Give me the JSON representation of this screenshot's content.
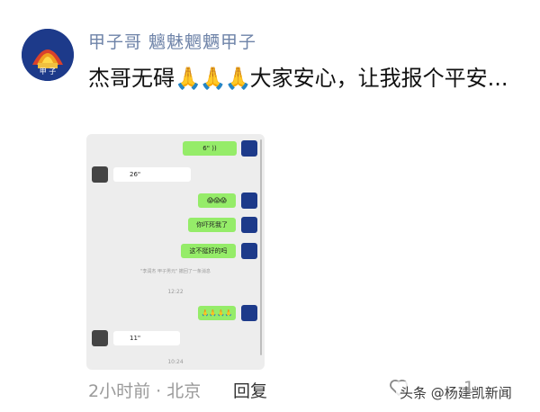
{
  "post": {
    "username": "甲子哥 魑魅魍魉甲子",
    "avatar_caption": "甲 子",
    "text_part1": "杰哥无碍",
    "emoji": "🙏🙏🙏",
    "text_part2": "大家安心，让我报个平安..."
  },
  "chat": {
    "m1": "6\"",
    "m2": "26\"",
    "m3": "😱😱😱",
    "m4": "你吓死我了",
    "m5": "这不挺好的吗",
    "sys": "\"李润杰 甲子男元\" 撤回了一条消息",
    "t1": "12:22",
    "m6": "🙏🙏🙏🙏",
    "m7": "11\"",
    "t2": "10:24"
  },
  "footer": {
    "time_location": "2小时前 · 北京",
    "reply": "回复",
    "watermark": "头条 @杨建凯新闻",
    "like_count": "1"
  }
}
